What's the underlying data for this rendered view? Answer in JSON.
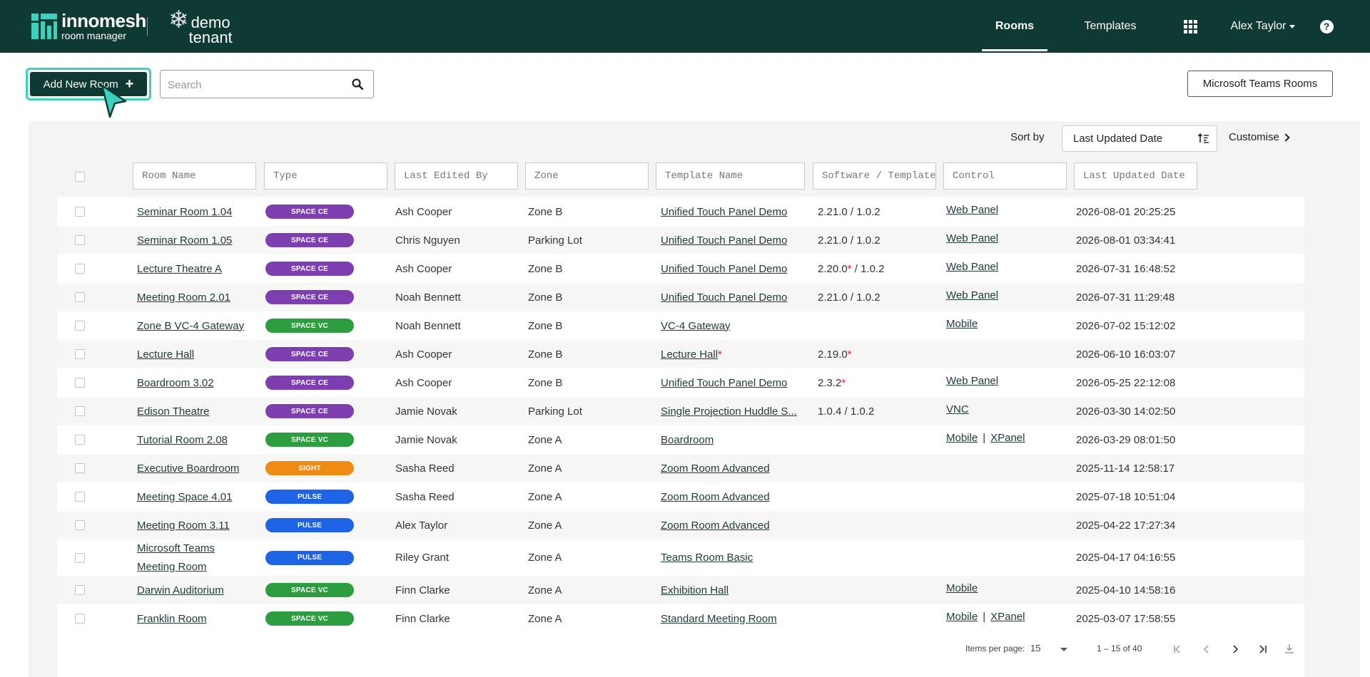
{
  "header": {
    "brand": "innomesh",
    "brand_sub": "room manager",
    "tenant_line1": "demo",
    "tenant_line2": "tenant",
    "nav_rooms": "Rooms",
    "nav_templates": "Templates",
    "user_name": "Alex Taylor",
    "help": "?"
  },
  "toolbar": {
    "add_label": "Add New Room",
    "add_plus": "+",
    "search_placeholder": "Search",
    "teams_label": "Microsoft Teams Rooms"
  },
  "sort": {
    "label": "Sort by",
    "value": "Last Updated Date",
    "customise": "Customise"
  },
  "columns": [
    "Room Name",
    "Type",
    "Last Edited By",
    "Zone",
    "Template Name",
    "Software / Template",
    "Control",
    "Last Updated Date"
  ],
  "badge_colors": {
    "SPACE CE": "#7d3fb0",
    "SPACE VC": "#2c9e3f",
    "SIGHT": "#f08a12",
    "PULSE": "#1e62e6"
  },
  "rows": [
    {
      "room": "Seminar Room 1.04",
      "type": "SPACE CE",
      "editor": "Ash Cooper",
      "zone": "Zone B",
      "template": "Unified Touch Panel Demo",
      "sw1": "2.21.0",
      "sw1_flag": "",
      "sw_sep": " / ",
      "sw2": "1.0.2",
      "control": [
        "Web Panel"
      ],
      "date": "2026-08-01 20:25:25"
    },
    {
      "room": "Seminar Room 1.05",
      "type": "SPACE CE",
      "editor": "Chris Nguyen",
      "zone": "Parking Lot",
      "template": "Unified Touch Panel Demo",
      "sw1": "2.21.0",
      "sw1_flag": "",
      "sw_sep": " / ",
      "sw2": "1.0.2",
      "control": [
        "Web Panel"
      ],
      "date": "2026-08-01 03:34:41"
    },
    {
      "room": "Lecture Theatre A",
      "type": "SPACE CE",
      "editor": "Ash Cooper",
      "zone": "Zone B",
      "template": "Unified Touch Panel Demo",
      "sw1": "2.20.0",
      "sw1_flag": " *",
      "sw_sep": " / ",
      "sw2": "1.0.2",
      "control": [
        "Web Panel"
      ],
      "date": "2026-07-31 16:48:52"
    },
    {
      "room": "Meeting Room 2.01",
      "type": "SPACE CE",
      "editor": "Noah Bennett",
      "zone": "Zone B",
      "template": "Unified Touch Panel Demo",
      "sw1": "2.21.0",
      "sw1_flag": "",
      "sw_sep": " / ",
      "sw2": "1.0.2",
      "control": [
        "Web Panel"
      ],
      "date": "2026-07-31 11:29:48"
    },
    {
      "room": "Zone B VC-4 Gateway",
      "type": "SPACE VC",
      "editor": "Noah Bennett",
      "zone": "Zone B",
      "template": "VC-4 Gateway",
      "template_flag": "",
      "sw1": "",
      "sw1_flag": "",
      "sw_sep": "",
      "sw2": "",
      "control": [
        "Mobile"
      ],
      "date": "2026-07-02 15:12:02"
    },
    {
      "room": "Lecture Hall",
      "type": "SPACE CE",
      "editor": "Ash Cooper",
      "zone": "Zone B",
      "template": "Lecture Hall",
      "template_flag": " *",
      "sw1": "2.19.0",
      "sw1_flag": " *",
      "sw_sep": "",
      "sw2": "",
      "control": [],
      "date": "2026-06-10 16:03:07"
    },
    {
      "room": "Boardroom 3.02",
      "type": "SPACE CE",
      "editor": "Ash Cooper",
      "zone": "Zone B",
      "template": "Unified Touch Panel Demo",
      "sw1": "2.3.2",
      "sw1_flag": " *",
      "sw_sep": "",
      "sw2": "",
      "control": [
        "Web Panel"
      ],
      "date": "2026-05-25 22:12:08"
    },
    {
      "room": "Edison Theatre",
      "type": "SPACE CE",
      "editor": "Jamie Novak",
      "zone": "Parking Lot",
      "template": "Single Projection Huddle S...",
      "sw1": "1.0.4",
      "sw1_flag": "",
      "sw_sep": " / ",
      "sw2": "1.0.2",
      "control": [
        "VNC"
      ],
      "date": "2026-03-30 14:02:50"
    },
    {
      "room": "Tutorial Room 2.08",
      "type": "SPACE VC",
      "editor": "Jamie Novak",
      "zone": "Zone A",
      "template": "Boardroom",
      "sw1": "",
      "sw1_flag": "",
      "sw_sep": "",
      "sw2": "",
      "control": [
        "Mobile",
        "XPanel"
      ],
      "date": "2026-03-29 08:01:50"
    },
    {
      "room": "Executive Boardroom",
      "type": "SIGHT",
      "editor": "Sasha Reed",
      "zone": "Zone A",
      "template": "Zoom Room Advanced",
      "sw1": "",
      "sw1_flag": "",
      "sw_sep": "",
      "sw2": "",
      "control": [],
      "date": "2025-11-14 12:58:17"
    },
    {
      "room": "Meeting Space 4.01",
      "type": "PULSE",
      "editor": "Sasha Reed",
      "zone": "Zone A",
      "template": "Zoom Room Advanced",
      "sw1": "",
      "sw1_flag": "",
      "sw_sep": "",
      "sw2": "",
      "control": [],
      "date": "2025-07-18 10:51:04"
    },
    {
      "room": "Meeting Room 3.11",
      "type": "PULSE",
      "editor": "Alex Taylor",
      "zone": "Zone A",
      "template": "Zoom Room Advanced",
      "sw1": "",
      "sw1_flag": "",
      "sw_sep": "",
      "sw2": "",
      "control": [],
      "date": "2025-04-22 17:27:34"
    },
    {
      "room": "Microsoft Teams",
      "room_line2": "Meeting Room",
      "type": "PULSE",
      "editor": "Riley Grant",
      "zone": "Zone A",
      "template": "Teams Room Basic",
      "sw1": "",
      "sw1_flag": "",
      "sw_sep": "",
      "sw2": "",
      "control": [],
      "date": "2025-04-17 04:16:55"
    },
    {
      "room": "Darwin Auditorium",
      "type": "SPACE VC",
      "editor": "Finn Clarke",
      "zone": "Zone A",
      "template": "Exhibition Hall",
      "sw1": "",
      "sw1_flag": "",
      "sw_sep": "",
      "sw2": "",
      "control": [
        "Mobile"
      ],
      "date": "2025-04-10 14:58:16"
    },
    {
      "room": "Franklin Room",
      "type": "SPACE VC",
      "editor": "Finn Clarke",
      "zone": "Zone A",
      "template": "Standard Meeting Room",
      "sw1": "",
      "sw1_flag": "",
      "sw_sep": "",
      "sw2": "",
      "control": [
        "Mobile",
        "XPanel"
      ],
      "date": "2025-03-07 17:58:55"
    }
  ],
  "control_separator": "|",
  "pagination": {
    "items_label": "Items per page:",
    "items_value": "15",
    "range": "1 – 15 of 40"
  }
}
